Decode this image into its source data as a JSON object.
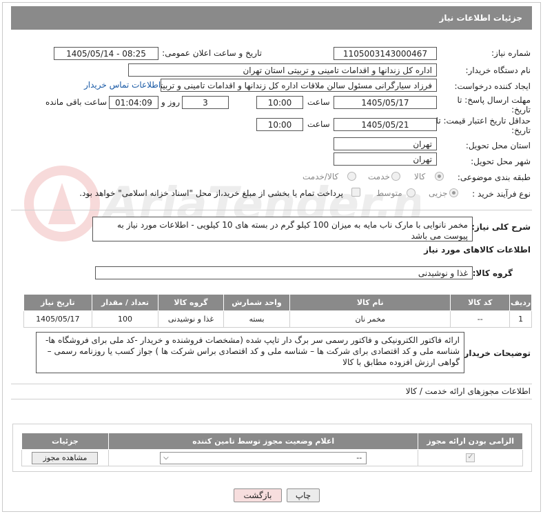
{
  "header": {
    "title": "جزئیات اطلاعات نیاز"
  },
  "form": {
    "need_number_label": "شماره نیاز:",
    "need_number": "1105003143000467",
    "announce_label": "تاریخ و ساعت اعلان عمومی:",
    "announce_value": "1405/05/14 - 08:25",
    "buyer_org_label": "نام دستگاه خریدار:",
    "buyer_org": "اداره کل زندانها و اقدامات تامینی و تربیتی استان تهران",
    "creator_label": "ایجاد کننده درخواست:",
    "creator": "فرزاد سیارگرانی مسئول سالن ملاقات  اداره کل زندانها و اقدامات تامینی و تربیتی",
    "contact_link": "اطلاعات تماس خریدار",
    "reply_deadline_label": "مهلت ارسال پاسخ: تا تاریخ:",
    "reply_date": "1405/05/17",
    "time_label": "ساعت",
    "reply_time": "10:00",
    "days_value": "3",
    "days_label": "روز و",
    "remaining_time": "01:04:09",
    "remaining_label": "ساعت باقی مانده",
    "price_deadline_label": "حداقل تاریخ اعتبار قیمت: تا تاریخ:",
    "price_date": "1405/05/21",
    "price_time": "10:00",
    "province_label": "استان محل تحویل:",
    "province": "تهران",
    "city_label": "شهر محل تحویل:",
    "city": "تهران",
    "category_label": "طبقه بندی موضوعی:",
    "category_options": [
      "کالا",
      "خدمت",
      "کالا/خدمت"
    ],
    "process_label": "نوع فرآیند خرید :",
    "process_options": [
      "جزیی",
      "متوسط"
    ],
    "payment_note": "پرداخت تمام یا بخشی از مبلغ خرید،از محل \"اسناد خزانه اسلامی\" خواهد بود."
  },
  "description": {
    "label": "شرح کلی نیاز:",
    "text": "مخمر نانوایی با مارک ناب مایه به میزان 100 کیلو گرم در بسته های 10 کیلویی - اطلاعات مورد نیاز به پیوست می باشد"
  },
  "goods": {
    "section_title": "اطلاعات کالاهای مورد نیاز",
    "group_label": "گروه کالا:",
    "group_value": "غذا و نوشیدنی",
    "columns": [
      "ردیف",
      "کد کالا",
      "نام کالا",
      "واحد شمارش",
      "گروه کالا",
      "تعداد / مقدار",
      "تاریخ نیاز"
    ],
    "rows": [
      [
        "1",
        "--",
        "مخمر نان",
        "بسته",
        "غذا و نوشیدنی",
        "100",
        "1405/05/17"
      ]
    ]
  },
  "buyer_notes": {
    "label": "توضیحات خریدار:",
    "text": "ارائه فاکتور الکترونیکی و فاکتور رسمی سر برگ دار تایپ شده (مشخصات فروشنده و خریدار -کد ملی برای فروشگاه ها-شناسه ملی و کد اقتصادی برای شرکت ها – شناسه ملی و کد اقتصادی براس شرکت ها ) جواز کسب یا روزنامه رسمی –گواهی ارزش افزوده مطابق با کالا"
  },
  "permits": {
    "section_title": "اطلاعات مجوزهای ارائه خدمت / کالا",
    "columns": [
      "الزامی بودن ارائه مجوز",
      "اعلام وضعیت مجوز توسط تامین کننده",
      "جزئیات"
    ],
    "select_value": "--",
    "view_button": "مشاهده مجوز"
  },
  "footer": {
    "print_button": "چاپ",
    "back_button": "بازگشت"
  },
  "watermark": {
    "text": "AriaTender.neT"
  },
  "colors": {
    "header_bg": "#8a8a8a",
    "link": "#1a5aa6",
    "back_button_bg": "#f7dede"
  }
}
